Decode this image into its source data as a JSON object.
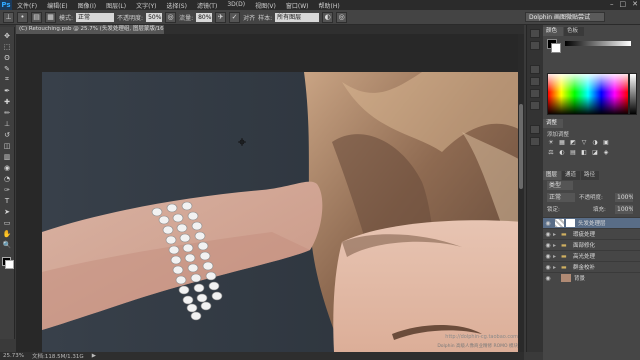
{
  "app": {
    "logo": "Ps"
  },
  "menu": [
    "文件(F)",
    "编辑(E)",
    "图像(I)",
    "图层(L)",
    "文字(Y)",
    "选择(S)",
    "滤镜(T)",
    "3D(D)",
    "视图(V)",
    "窗口(W)",
    "帮助(H)"
  ],
  "window_controls": {
    "minimize": "–",
    "maximize": "□",
    "close": "✕"
  },
  "options": {
    "mode_label": "模式:",
    "mode_value": "正常",
    "opacity_label": "不透明度:",
    "opacity_value": "50%",
    "flow_label": "流量:",
    "flow_value": "80%",
    "align_label": "对齐",
    "sample_label": "样本:",
    "sample_value": "所有图层",
    "workspace": "Dolphin 画图微贴尝试"
  },
  "document": {
    "tab_title": "(C) Retouching.psb @ 25.7% (头发处理组, 图层蒙版/16) *"
  },
  "status": {
    "zoom": "25.73%",
    "doc_size": "文档:118.5M/1.31G"
  },
  "watermark": {
    "line1": "http://dolphin-cg.taobao.com",
    "line2": "Dolphin 高级人像商业精修 ROMO 模块"
  },
  "panels": {
    "color_tab": "颜色",
    "swatches_tab": "色板",
    "adjustments_tab": "调整",
    "add_adjustment_label": "添加调整",
    "layers_tab": "图层",
    "channels_tab": "通道",
    "paths_tab": "路径",
    "kind_label": "类型",
    "blend_mode": "正常",
    "opacity_label": "不透明度:",
    "opacity_value": "100%",
    "lock_label": "锁定:",
    "fill_label": "填充:",
    "fill_value": "100%"
  },
  "layers": [
    {
      "name": "头发处理层",
      "type": "mask",
      "selected": true
    },
    {
      "name": "瑕疵处理",
      "type": "group"
    },
    {
      "name": "面部修化",
      "type": "group"
    },
    {
      "name": "高光处理",
      "type": "group"
    },
    {
      "name": "群金校补",
      "type": "group"
    },
    {
      "name": "背景",
      "type": "background"
    }
  ],
  "colors": {
    "accent": "#31a8ff",
    "selected_layer": "#596d87"
  },
  "icons": [
    "move-icon",
    "marquee-icon",
    "lasso-icon",
    "quick-select-icon",
    "crop-icon",
    "eyedropper-icon",
    "healing-icon",
    "brush-icon",
    "clone-stamp-icon",
    "history-brush-icon",
    "eraser-icon",
    "gradient-icon",
    "blur-icon",
    "dodge-icon",
    "pen-icon",
    "type-icon",
    "path-select-icon",
    "shape-icon",
    "hand-icon",
    "zoom-icon",
    "eye-icon",
    "folder-icon"
  ]
}
